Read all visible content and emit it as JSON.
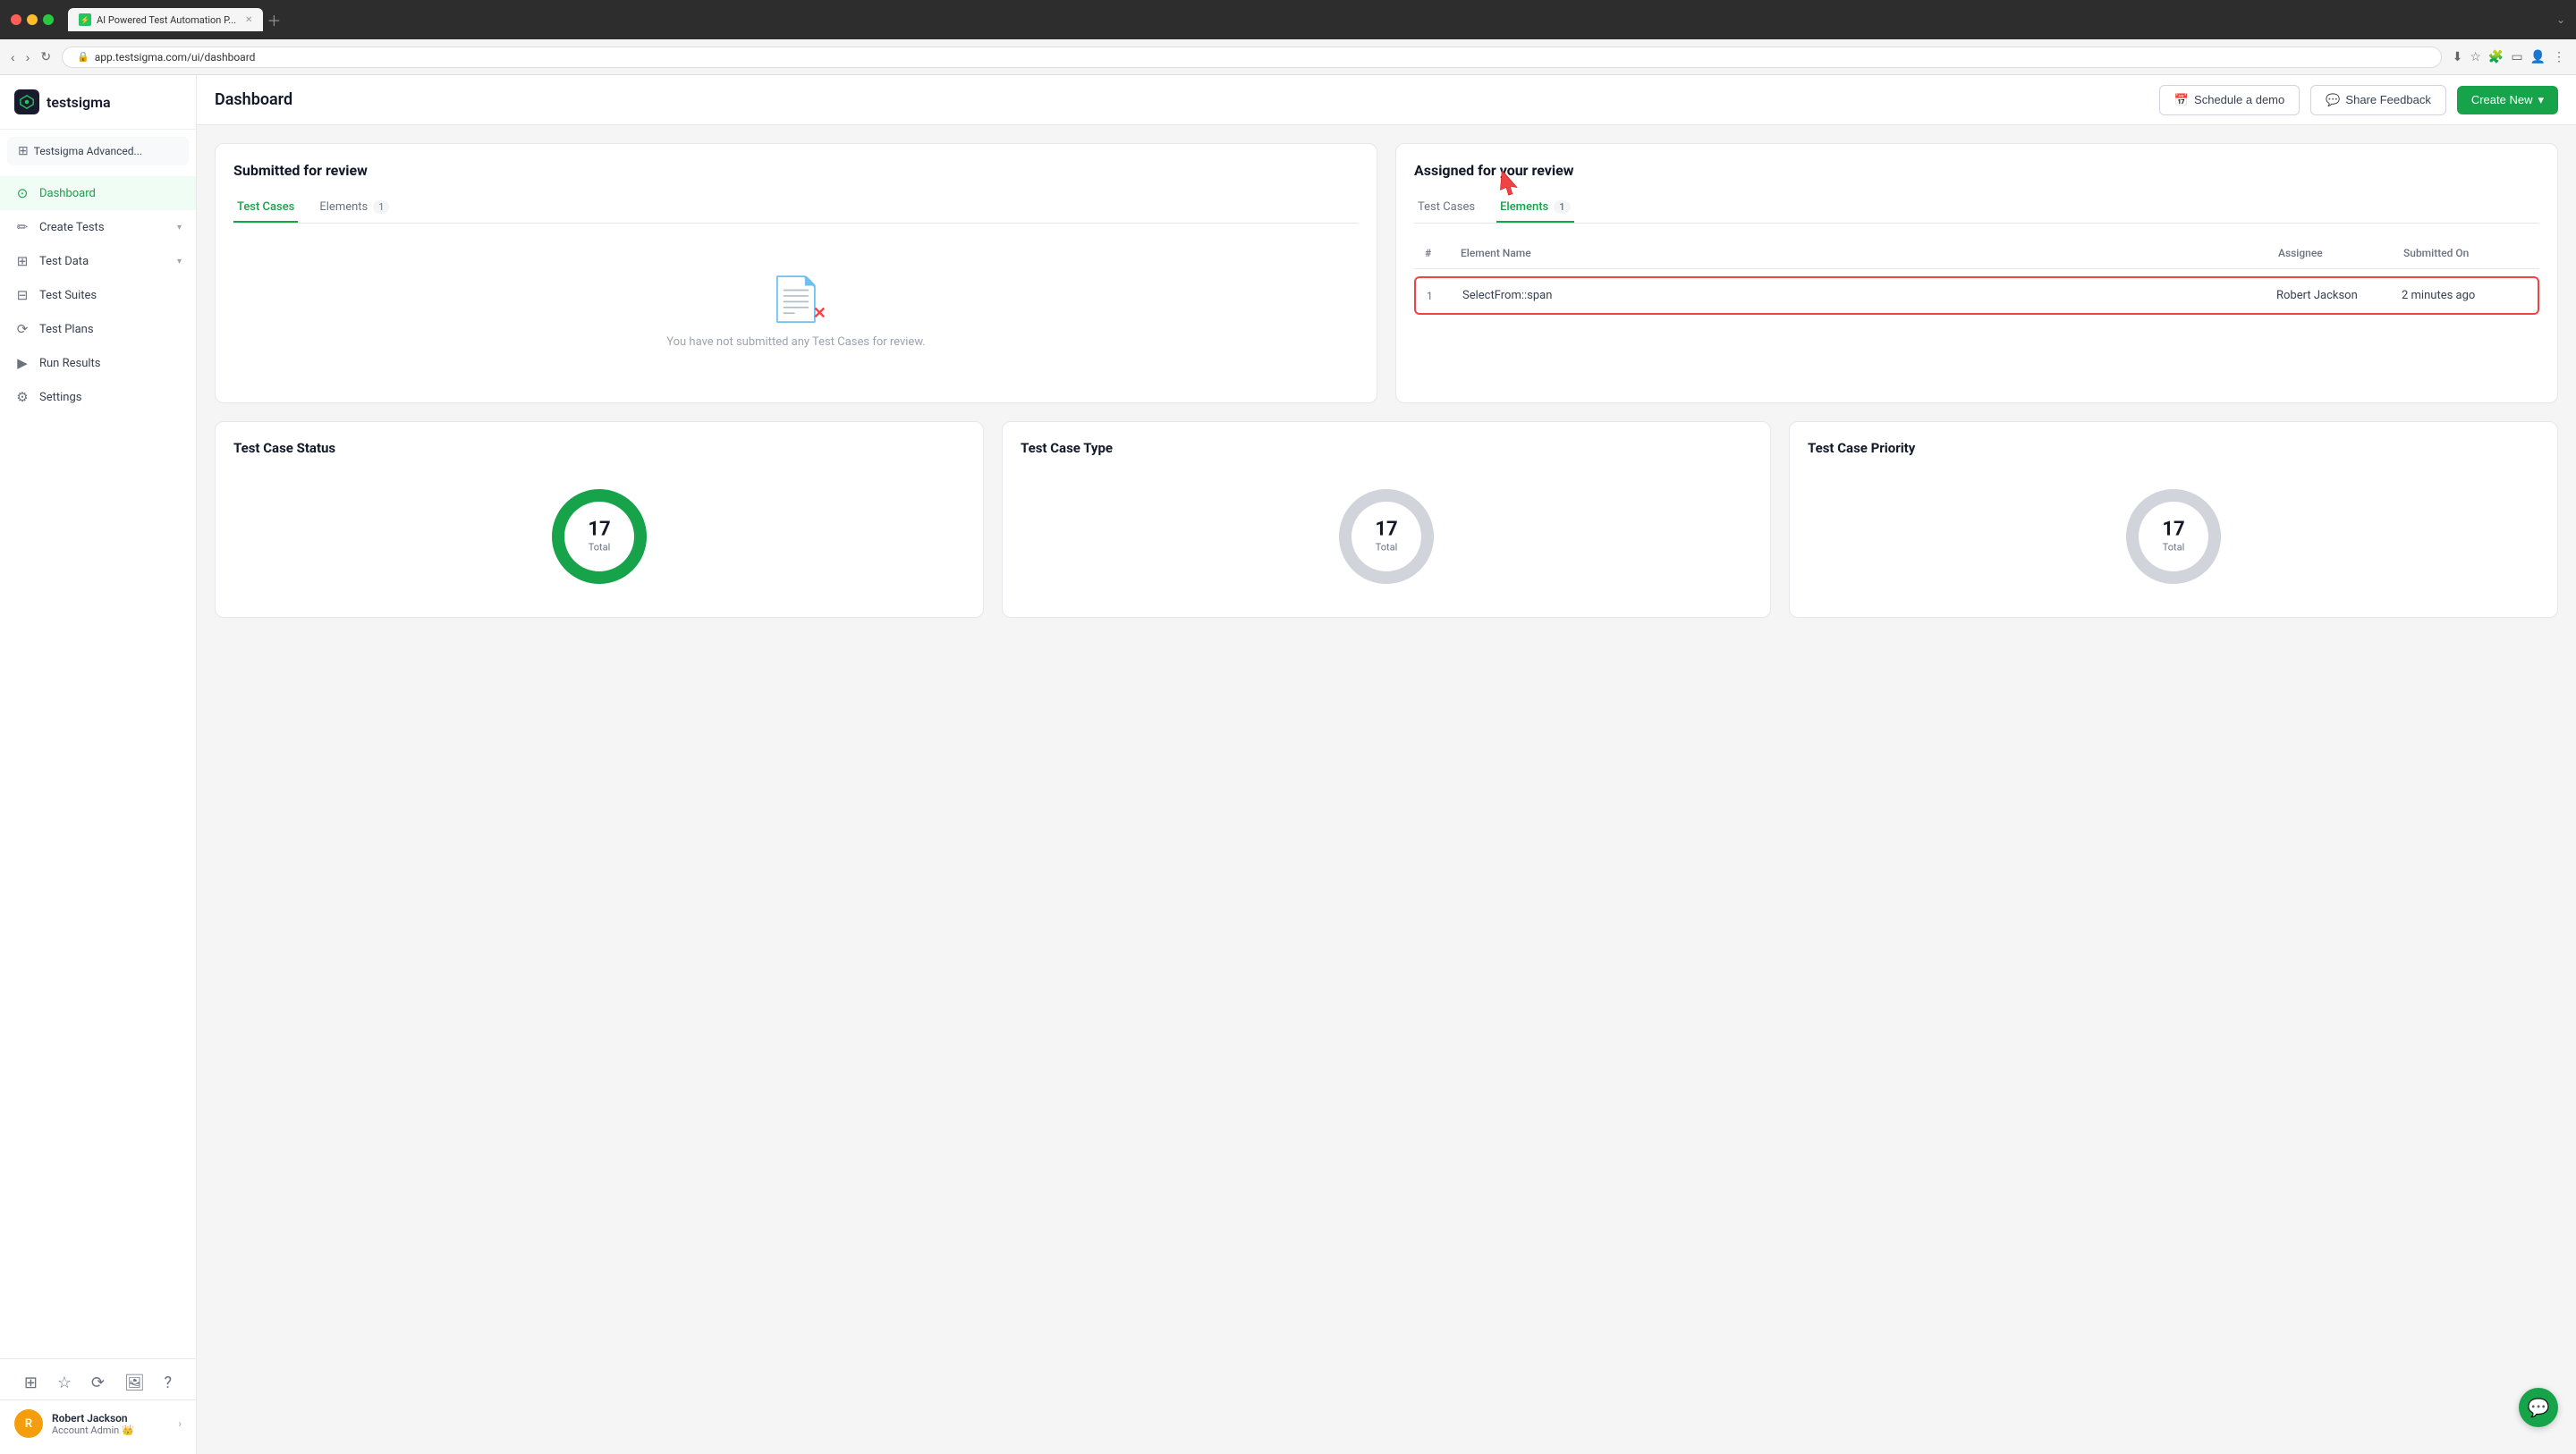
{
  "browser": {
    "tab_label": "AI Powered Test Automation P...",
    "url": "app.testsigma.com/ui/dashboard"
  },
  "sidebar": {
    "logo_text": "testsigma",
    "workspace_label": "Testsigma Advanced...",
    "nav_items": [
      {
        "id": "dashboard",
        "label": "Dashboard",
        "icon": "⊙",
        "active": true
      },
      {
        "id": "create-tests",
        "label": "Create Tests",
        "icon": "✏",
        "has_arrow": true
      },
      {
        "id": "test-data",
        "label": "Test Data",
        "icon": "⊞",
        "has_arrow": true
      },
      {
        "id": "test-suites",
        "label": "Test Suites",
        "icon": "⊟",
        "has_arrow": false
      },
      {
        "id": "test-plans",
        "label": "Test Plans",
        "icon": "⟳",
        "has_arrow": false
      },
      {
        "id": "run-results",
        "label": "Run Results",
        "icon": "▶",
        "has_arrow": false
      },
      {
        "id": "settings",
        "label": "Settings",
        "icon": "⚙",
        "has_arrow": false
      }
    ],
    "user": {
      "name": "Robert Jackson",
      "role": "Account Admin",
      "initial": "R",
      "emoji": "👑"
    }
  },
  "header": {
    "title": "Dashboard",
    "schedule_demo_label": "Schedule a demo",
    "share_feedback_label": "Share Feedback",
    "create_new_label": "Create New"
  },
  "submitted_for_review": {
    "card_title": "Submitted for review",
    "tabs": [
      {
        "id": "test-cases",
        "label": "Test Cases",
        "active": true,
        "count": null
      },
      {
        "id": "elements",
        "label": "Elements",
        "active": false,
        "count": "1"
      }
    ],
    "empty_message": "You have not submitted any Test Cases for review."
  },
  "assigned_for_review": {
    "card_title": "Assigned for your review",
    "tabs": [
      {
        "id": "test-cases",
        "label": "Test Cases",
        "active": false,
        "count": null
      },
      {
        "id": "elements",
        "label": "Elements",
        "active": true,
        "count": "1"
      }
    ],
    "table": {
      "columns": [
        "#",
        "Element Name",
        "Assignee",
        "Submitted On"
      ],
      "rows": [
        {
          "num": "1",
          "element_name": "SelectFrom::span",
          "assignee": "Robert Jackson",
          "submitted_on": "2 minutes ago"
        }
      ]
    }
  },
  "stats": [
    {
      "id": "test-case-status",
      "title": "Test Case Status",
      "total": 17,
      "total_label": "Total",
      "color": "#16a34a"
    },
    {
      "id": "test-case-type",
      "title": "Test Case Type",
      "total": 17,
      "total_label": "Total",
      "color": "#d1d5db"
    },
    {
      "id": "test-case-priority",
      "title": "Test Case Priority",
      "total": 17,
      "total_label": "Total",
      "color": "#d1d5db"
    }
  ]
}
